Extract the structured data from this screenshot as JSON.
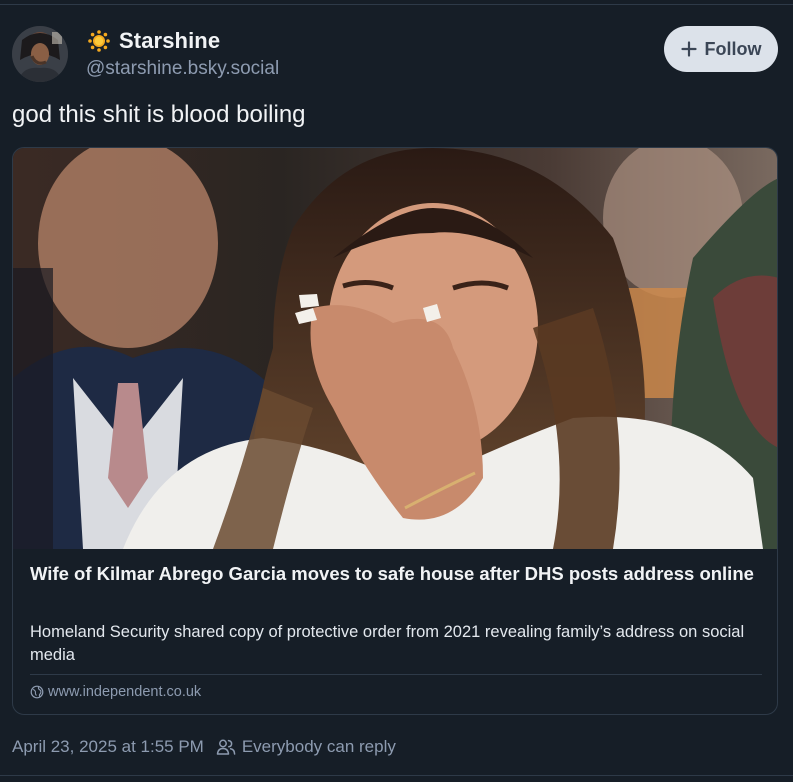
{
  "post": {
    "author": {
      "display_name": "Starshine",
      "handle": "@starshine.bsky.social",
      "avatar_icon": "avatar-image",
      "badge_icon": "sun-emoji-icon"
    },
    "follow_label": "Follow",
    "text": "god this shit is blood boiling",
    "embed": {
      "title": "Wife of Kilmar Abrego Garcia moves to safe house after DHS posts address online",
      "description": "Homeland Security shared copy of protective order from 2021 revealing family’s address on social media",
      "domain": "www.independent.co.uk",
      "thumbnail_icon": "news-photo-thumbnail"
    },
    "timestamp": "April 23, 2025 at 1:55 PM",
    "reply_setting": "Everybody can reply"
  },
  "colors": {
    "background": "#161e27",
    "text_primary": "#f1f3f5",
    "text_secondary": "#8d9bb0",
    "border": "#2e3a48",
    "follow_button_bg": "#dce2ea",
    "follow_button_text": "#3b4656",
    "badge": "#f4a91f"
  }
}
